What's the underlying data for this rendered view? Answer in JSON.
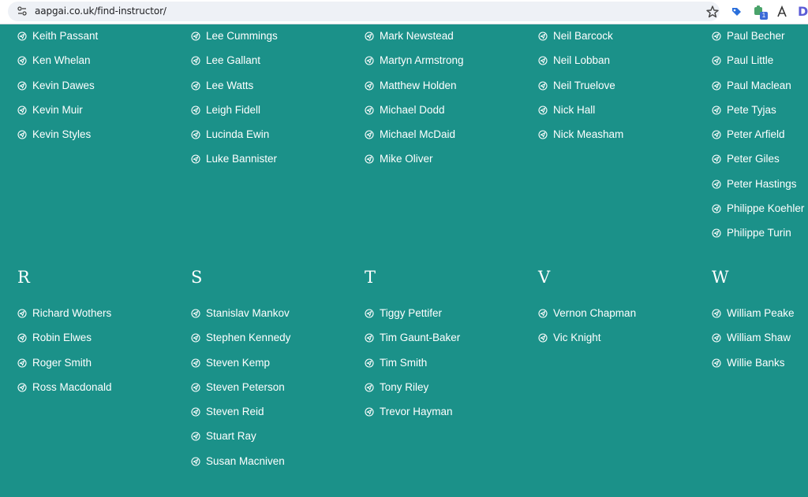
{
  "browser": {
    "url": "aapgai.co.uk/find-instructor/",
    "extension_badge": "1",
    "extension_letter": "D"
  },
  "sections_top": [
    {
      "names": [
        "Keith Passant",
        "Ken Whelan",
        "Kevin Dawes",
        "Kevin Muir",
        "Kevin Styles"
      ]
    },
    {
      "names": [
        "Lee Cummings",
        "Lee Gallant",
        "Lee Watts",
        "Leigh Fidell",
        "Lucinda Ewin",
        "Luke Bannister"
      ]
    },
    {
      "names": [
        "Mark Newstead",
        "Martyn Armstrong",
        "Matthew Holden",
        "Michael Dodd",
        "Michael McDaid",
        "Mike Oliver"
      ]
    },
    {
      "names": [
        "Neil Barcock",
        "Neil Lobban",
        "Neil Truelove",
        "Nick Hall",
        "Nick Measham"
      ]
    },
    {
      "names": [
        "Paul Becher",
        "Paul Little",
        "Paul Maclean",
        "Pete Tyjas",
        "Peter Arfield",
        "Peter Giles",
        "Peter Hastings",
        "Philippe Koehler",
        "Philippe Turin"
      ]
    }
  ],
  "sections_bottom": [
    {
      "letter": "R",
      "names": [
        "Richard Wothers",
        "Robin Elwes",
        "Roger Smith",
        "Ross Macdonald"
      ]
    },
    {
      "letter": "S",
      "names": [
        "Stanislav Mankov",
        "Stephen Kennedy",
        "Steven Kemp",
        "Steven Peterson",
        "Steven Reid",
        "Stuart Ray",
        "Susan Macniven"
      ]
    },
    {
      "letter": "T",
      "names": [
        "Tiggy Pettifer",
        "Tim Gaunt-Baker",
        "Tim Smith",
        "Tony Riley",
        "Trevor Hayman"
      ]
    },
    {
      "letter": "V",
      "names": [
        "Vernon Chapman",
        "Vic Knight"
      ]
    },
    {
      "letter": "W",
      "names": [
        "William Peake",
        "William Shaw",
        "Willie Banks"
      ]
    }
  ],
  "colors": {
    "background": "#1b9189",
    "text": "#ffffff",
    "address_bar": "#eef1f6"
  }
}
